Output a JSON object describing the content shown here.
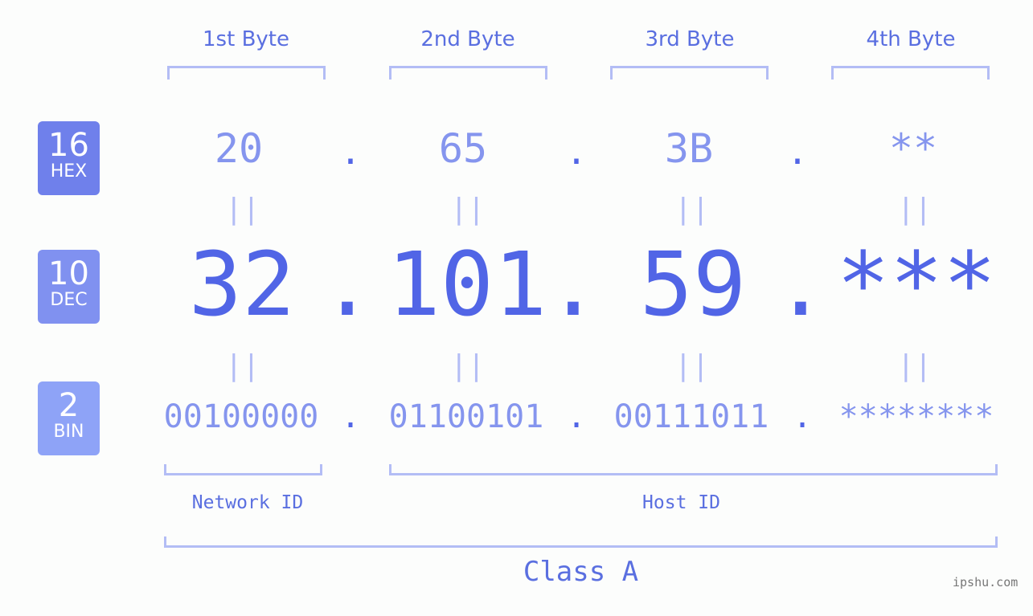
{
  "bytes": [
    {
      "label": "1st Byte",
      "hex": "20",
      "dec": "32",
      "bin": "00100000"
    },
    {
      "label": "2nd Byte",
      "hex": "65",
      "dec": "101",
      "bin": "01100101"
    },
    {
      "label": "3rd Byte",
      "hex": "3B",
      "dec": "59",
      "bin": "00111011"
    },
    {
      "label": "4th Byte",
      "hex": "**",
      "dec": "***",
      "bin": "********"
    }
  ],
  "bases": {
    "hex": {
      "num": "16",
      "label": "HEX",
      "color": "#6f80eb"
    },
    "dec": {
      "num": "10",
      "label": "DEC",
      "color": "#8091f0"
    },
    "bin": {
      "num": "2",
      "label": "BIN",
      "color": "#8ea3f7"
    }
  },
  "separator": ".",
  "equals": "||",
  "network_id": "Network ID",
  "host_id": "Host ID",
  "class_label": "Class A",
  "watermark": "ipshu.com"
}
